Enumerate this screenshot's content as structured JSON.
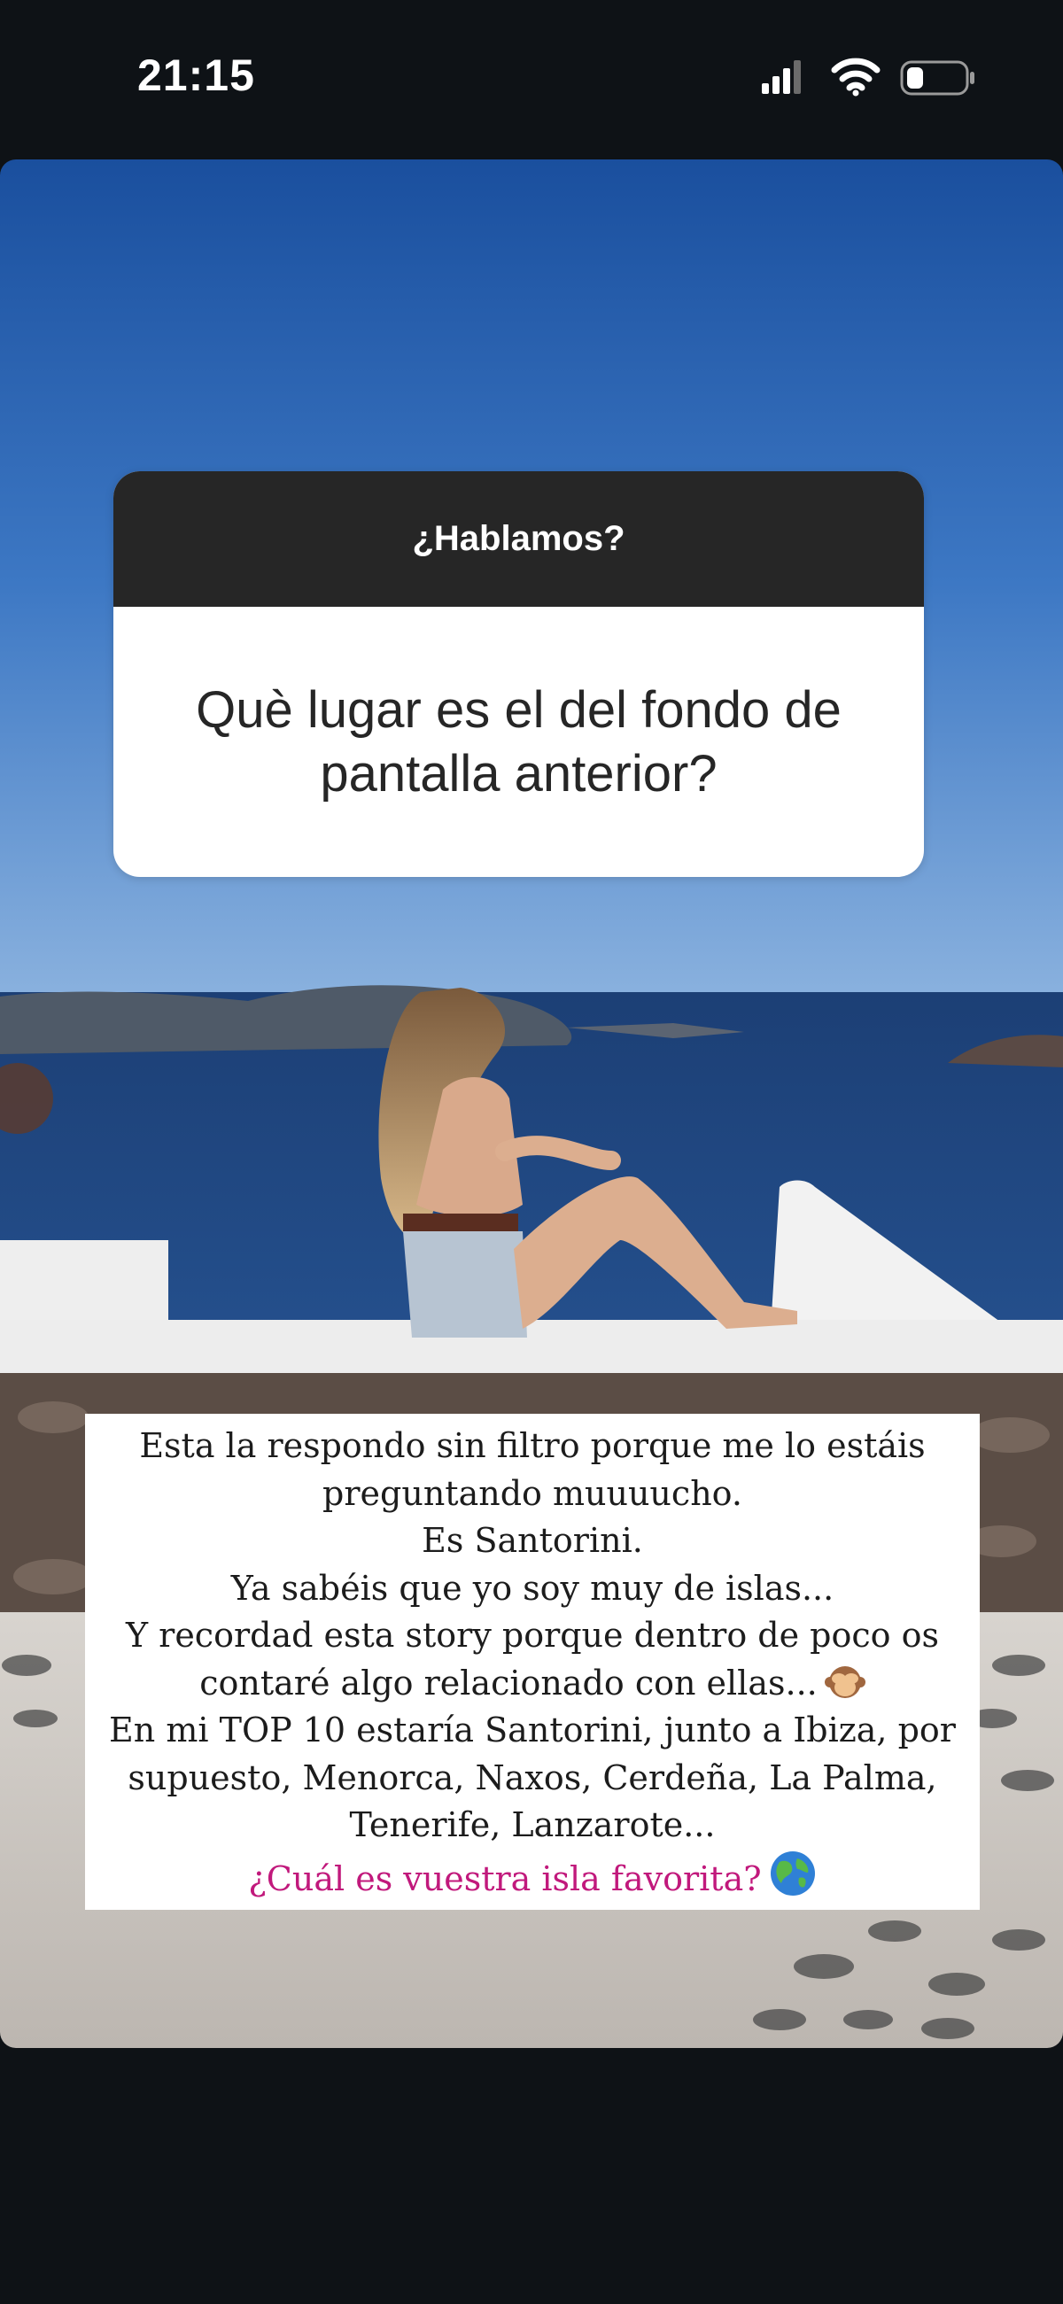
{
  "status_bar": {
    "time": "21:15",
    "signal_icon": "cellular-signal-icon",
    "wifi_icon": "wifi-icon",
    "battery_icon": "battery-icon"
  },
  "story": {
    "background_image": "santorini-sea-view-photo",
    "question_sticker": {
      "header": "¿Hablamos?",
      "question": "Què lugar es el del fondo de pantalla anterior?"
    },
    "caption": {
      "lines": [
        "Esta la respondo sin filtro porque me lo estáis",
        "preguntando muuuucho.",
        "Es Santorini.",
        "Ya sabéis que yo soy muy de islas...",
        "Y recordad esta story porque dentro de poco os",
        "contaré algo relacionado con ellas...",
        "En mi TOP 10 estaría Santorini, junto a Ibiza, por",
        "supuesto, Menorca, Naxos, Cerdeña, La Palma,",
        "Tenerife, Lanzarote..."
      ],
      "highlight": "¿Cuál es vuestra isla favorita?",
      "emoji_1": "see-no-evil-monkey-icon",
      "emoji_2": "globe-icon"
    }
  },
  "colors": {
    "highlight_pink": "#c1197c",
    "sticker_header": "#262626"
  }
}
